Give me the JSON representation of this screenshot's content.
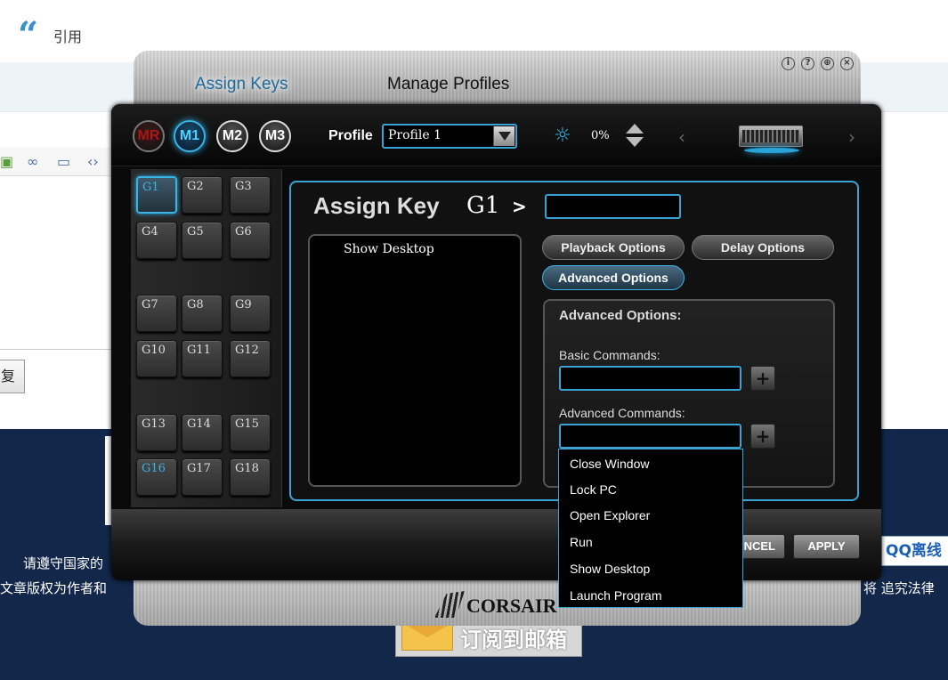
{
  "background": {
    "quote_label": "引用",
    "reply_label": "复",
    "notice_left": "请遵守国家的",
    "copyright_left": "文章版权为作者和",
    "copyright_right": "将  追究法律",
    "qq_label": "QQ离线",
    "subscribe_label": "订阅到邮箱"
  },
  "app": {
    "brand": "CORSAIR",
    "tabs": [
      "Assign Keys",
      "Manage Profiles"
    ],
    "active_tab": "Assign Keys",
    "window_controls": [
      "info-icon",
      "help-icon",
      "globe-icon",
      "close-icon"
    ]
  },
  "mode_buttons": [
    "MR",
    "M1",
    "M2",
    "M3"
  ],
  "active_mode": "M1",
  "profile": {
    "label": "Profile",
    "value": "Profile 1"
  },
  "brightness": {
    "value": "0%"
  },
  "gkeys": [
    "G1",
    "G2",
    "G3",
    "G4",
    "G5",
    "G6",
    "G7",
    "G8",
    "G9",
    "G10",
    "G11",
    "G12",
    "G13",
    "G14",
    "G15",
    "G16",
    "G17",
    "G18"
  ],
  "selected_gkey": "G1",
  "assign": {
    "title": "Assign Key",
    "key": "G1",
    "arrow": ">",
    "name_value": "",
    "macro_items": [
      "Show Desktop"
    ]
  },
  "options": {
    "playback": "Playback Options",
    "delay": "Delay Options",
    "advanced": "Advanced Options",
    "active": "Advanced Options"
  },
  "advanced": {
    "title": "Advanced Options:",
    "basic_label": "Basic Commands:",
    "advanced_label": "Advanced Commands:",
    "basic_value": "",
    "advanced_value": ""
  },
  "dropdown": {
    "items": [
      "Close Window",
      "Lock PC",
      "Open Explorer",
      "Run",
      "Show Desktop",
      "Launch Program"
    ]
  },
  "buttons": {
    "cancel": "NCEL",
    "apply": "APPLY"
  },
  "colors": {
    "accent": "#3aa3d6",
    "panel": "#0a0a0a",
    "page_navy": "#13274a"
  }
}
